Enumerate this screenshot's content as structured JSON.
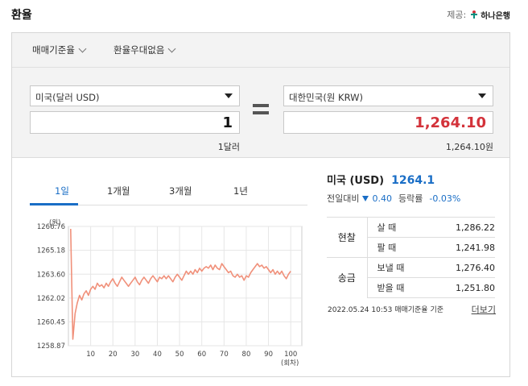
{
  "header": {
    "title": "환율",
    "provider_label": "제공:",
    "provider_name": "하나은행"
  },
  "options": {
    "basis": "매매기준율",
    "discount": "환율우대없음"
  },
  "converter": {
    "from_currency": "미국(달러 USD)",
    "from_amount": "1",
    "from_caption": "1달러",
    "to_currency": "대한민국(원 KRW)",
    "to_amount": "1,264.10",
    "to_caption": "1,264.10원"
  },
  "tabs": [
    {
      "label": "1일",
      "active": true
    },
    {
      "label": "1개월",
      "active": false
    },
    {
      "label": "3개월",
      "active": false
    },
    {
      "label": "1년",
      "active": false
    }
  ],
  "summary": {
    "country": "미국 (USD)",
    "rate": "1264.1",
    "change_label": "전일대비",
    "change_value": "0.40",
    "pct_label": "등락률",
    "pct_value": "-0.03%"
  },
  "rates_table": {
    "cash_group": "현찰",
    "cash_buy_label": "살 때",
    "cash_buy": "1,286.22",
    "cash_sell_label": "팔 때",
    "cash_sell": "1,241.98",
    "remit_group": "송금",
    "remit_send_label": "보낼 때",
    "remit_send": "1,276.40",
    "remit_recv_label": "받을 때",
    "remit_recv": "1,251.80"
  },
  "footnote": {
    "text": "2022.05.24 10:53 매매기준율 기준",
    "detail": "더보기"
  },
  "colors": {
    "accent": "#1a6ec6",
    "red": "#d3323a",
    "line": "#f0907a"
  },
  "chart_data": {
    "type": "line",
    "ylabel": "(원)",
    "xlabel": "(회차)",
    "y_ticks": [
      "1266.76",
      "1265.18",
      "1263.60",
      "1262.02",
      "1260.45",
      "1258.87"
    ],
    "ylim": [
      1258.87,
      1266.76
    ],
    "x_ticks": [
      10,
      20,
      30,
      40,
      50,
      60,
      70,
      80,
      90,
      100
    ],
    "xlim": [
      0,
      105
    ],
    "grid": true,
    "series": [
      {
        "values": [
          1266.6,
          1259.3,
          1261.0,
          1261.7,
          1262.2,
          1261.9,
          1262.3,
          1262.5,
          1262.2,
          1262.6,
          1262.8,
          1262.6,
          1263.0,
          1262.8,
          1262.9,
          1262.7,
          1263.0,
          1262.8,
          1263.1,
          1263.3,
          1263.0,
          1262.8,
          1263.1,
          1263.4,
          1263.2,
          1263.0,
          1262.8,
          1263.0,
          1263.2,
          1263.4,
          1263.1,
          1262.9,
          1263.2,
          1263.4,
          1263.2,
          1263.0,
          1263.3,
          1263.5,
          1263.3,
          1263.1,
          1263.4,
          1263.3,
          1263.5,
          1263.3,
          1263.5,
          1263.3,
          1263.1,
          1263.4,
          1263.6,
          1263.4,
          1263.2,
          1263.5,
          1263.8,
          1263.6,
          1263.8,
          1263.6,
          1263.9,
          1263.7,
          1264.0,
          1263.8,
          1264.0,
          1264.1,
          1264.0,
          1264.2,
          1263.9,
          1264.2,
          1264.0,
          1263.9,
          1264.3,
          1264.1,
          1263.9,
          1263.7,
          1263.8,
          1263.5,
          1263.4,
          1263.6,
          1263.4,
          1263.5,
          1263.2,
          1263.5,
          1263.4,
          1263.7,
          1263.9,
          1264.1,
          1264.3,
          1264.1,
          1264.2,
          1264.0,
          1264.1,
          1263.9,
          1263.7,
          1263.9,
          1263.6,
          1263.8,
          1263.6,
          1263.8,
          1263.5,
          1263.3,
          1263.6,
          1263.8
        ]
      }
    ]
  }
}
